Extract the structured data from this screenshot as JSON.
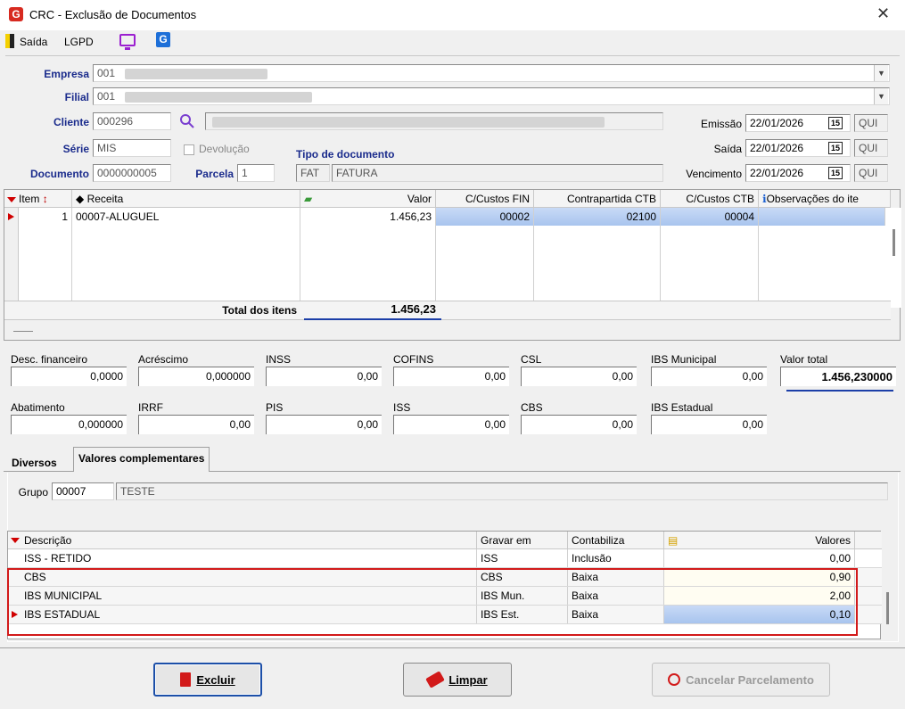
{
  "window": {
    "title": "CRC - Exclusão de Documentos",
    "logo": "G",
    "close": "✕"
  },
  "toolbar": {
    "exit_label": "Saída",
    "lgpd_label": "LGPD",
    "g_label": "G"
  },
  "header": {
    "empresa_label": "Empresa",
    "empresa_value": "001",
    "filial_label": "Filial",
    "filial_value": "001",
    "cliente_label": "Cliente",
    "cliente_value": "000296",
    "serie_label": "Série",
    "serie_value": "MIS",
    "devolucao_label": "Devolução",
    "documento_label": "Documento",
    "documento_value": "0000000005",
    "parcela_label": "Parcela",
    "parcela_value": "1",
    "tipo_doc_label": "Tipo de documento",
    "tipo_code": "FAT",
    "tipo_desc": "FATURA",
    "emissao_label": "Emissão",
    "emissao_value": "22/01/2026",
    "emissao_day": "QUI",
    "saida_label": "Saída",
    "saida_value": "22/01/2026",
    "saida_day": "QUI",
    "vencimento_label": "Vencimento",
    "vencimento_value": "22/01/2026",
    "vencimento_day": "QUI",
    "cal_text": "15"
  },
  "items_grid": {
    "headers": [
      "Item",
      "Receita",
      "Valor",
      "C/Custos FIN",
      "Contrapartida CTB",
      "C/Custos CTB",
      "Observações do ite"
    ],
    "row": {
      "item": "1",
      "receita": "00007-ALUGUEL",
      "valor": "1.456,23",
      "ccfin": "00002",
      "contrapartida": "02100",
      "ccctb": "00004",
      "obs": ""
    },
    "total_label": "Total dos itens",
    "total_value": "1.456,23"
  },
  "values": {
    "desc_fin_label": "Desc. financeiro",
    "desc_fin": "0,0000",
    "acrescimo_label": "Acréscimo",
    "acrescimo": "0,000000",
    "inss_label": "INSS",
    "inss": "0,00",
    "cofins_label": "COFINS",
    "cofins": "0,00",
    "csl_label": "CSL",
    "csl": "0,00",
    "ibs_mun_label": "IBS Municipal",
    "ibs_mun": "0,00",
    "valor_total_label": "Valor total",
    "valor_total": "1.456,230000",
    "abatimento_label": "Abatimento",
    "abatimento": "0,000000",
    "irrf_label": "IRRF",
    "irrf": "0,00",
    "pis_label": "PIS",
    "pis": "0,00",
    "iss_label": "ISS",
    "iss": "0,00",
    "cbs_label": "CBS",
    "cbs": "0,00",
    "ibs_est_label": "IBS Estadual",
    "ibs_est": "0,00"
  },
  "tabs": {
    "diversos": "Diversos",
    "complementares": "Valores complementares"
  },
  "grupo": {
    "label": "Grupo",
    "code": "00007",
    "desc": "TESTE"
  },
  "comp_grid": {
    "headers": [
      "Descrição",
      "Gravar em",
      "Contabiliza",
      "Valores"
    ],
    "rows": [
      {
        "desc": "ISS - RETIDO",
        "gravar": "ISS",
        "contab": "Inclusão",
        "valor": "0,00"
      },
      {
        "desc": "CBS",
        "gravar": "CBS",
        "contab": "Baixa",
        "valor": "0,90"
      },
      {
        "desc": "IBS MUNICIPAL",
        "gravar": "IBS Mun.",
        "contab": "Baixa",
        "valor": "2,00"
      },
      {
        "desc": "IBS ESTADUAL",
        "gravar": "IBS Est.",
        "contab": "Baixa",
        "valor": "0,10"
      }
    ]
  },
  "buttons": {
    "excluir": "Excluir",
    "limpar": "Limpar",
    "cancelar": "Cancelar Parcelamento"
  },
  "colors": {
    "label_blue": "#1a2b8c",
    "highlight_red": "#d00000",
    "selection": "#a8c4ee"
  }
}
